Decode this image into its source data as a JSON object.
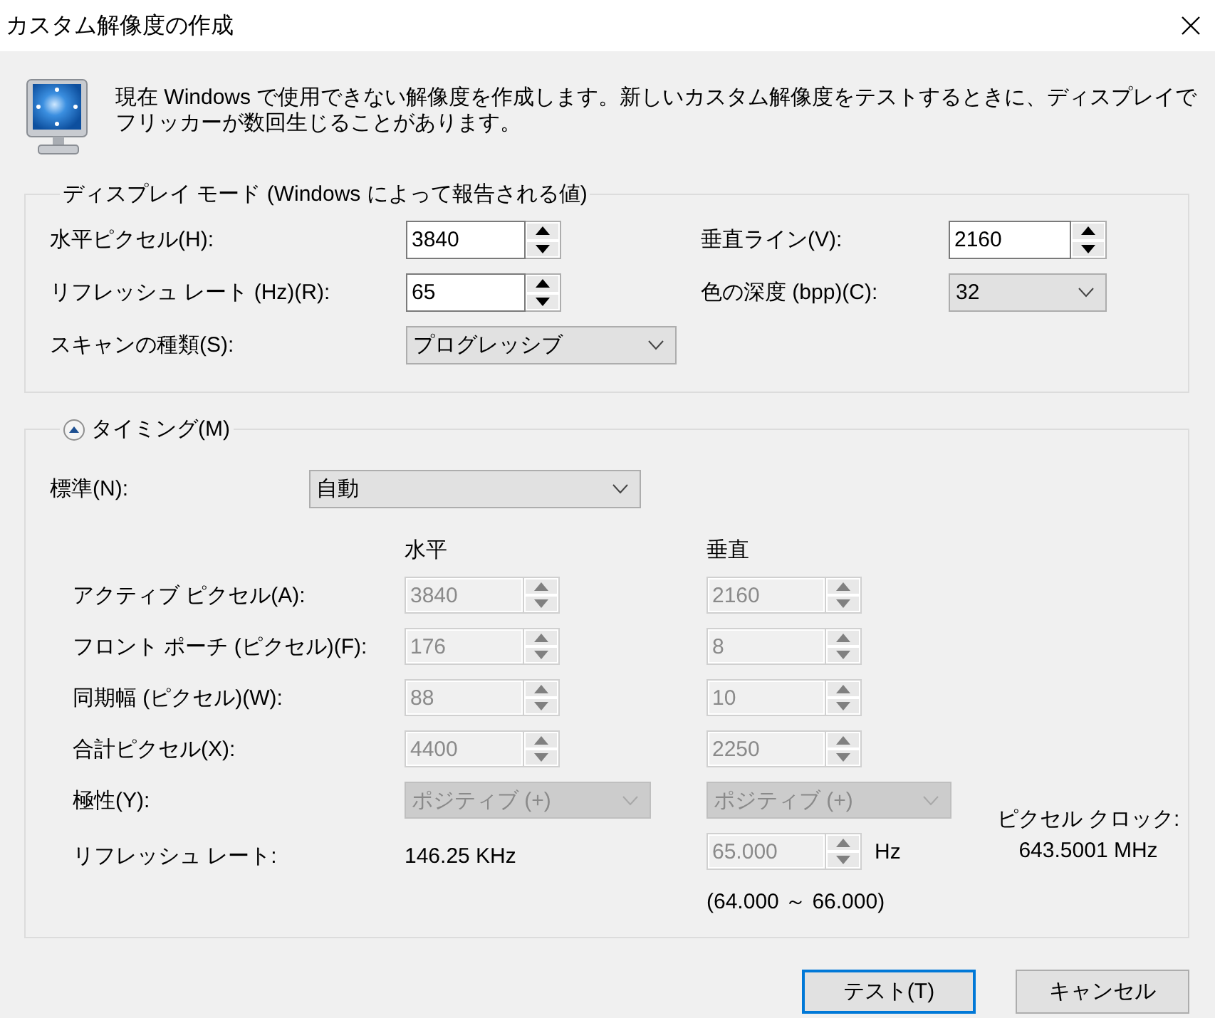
{
  "window": {
    "title": "カスタム解像度の作成"
  },
  "description": "現在 Windows で使用できない解像度を作成します。新しいカスタム解像度をテストするときに、ディスプレイでフリッカーが数回生じることがあります。",
  "display_mode": {
    "legend": "ディスプレイ モード (Windows によって報告される値)",
    "rows": [
      {
        "left": {
          "label": "水平ピクセル(H):",
          "kind": "spin",
          "value": "3840",
          "disabled": false
        },
        "right": {
          "label": "垂直ライン(V):",
          "kind": "spin",
          "value": "2160",
          "disabled": false
        }
      },
      {
        "left": {
          "label": "リフレッシュ レート (Hz)(R):",
          "kind": "spin",
          "value": "65",
          "disabled": false
        },
        "right": {
          "label": "色の深度 (bpp)(C):",
          "kind": "combo",
          "value": "32",
          "disabled": false
        }
      },
      {
        "left": {
          "label": "スキャンの種類(S):",
          "kind": "combo",
          "value": "プログレッシブ",
          "disabled": false
        }
      }
    ]
  },
  "timing": {
    "legend": "タイミング(M)",
    "expanded": true,
    "standard": {
      "label": "標準(N):",
      "value": "自動",
      "disabled": false
    },
    "columns": [
      "水平",
      "垂直"
    ],
    "rows": [
      {
        "label": "アクティブ ピクセル(A):",
        "horizontal": {
          "kind": "spin",
          "value": "3840",
          "disabled": true
        },
        "vertical": {
          "kind": "spin",
          "value": "2160",
          "disabled": true
        }
      },
      {
        "label": "フロント ポーチ (ピクセル)(F):",
        "horizontal": {
          "kind": "spin",
          "value": "176",
          "disabled": true
        },
        "vertical": {
          "kind": "spin",
          "value": "8",
          "disabled": true
        }
      },
      {
        "label": "同期幅 (ピクセル)(W):",
        "horizontal": {
          "kind": "spin",
          "value": "88",
          "disabled": true
        },
        "vertical": {
          "kind": "spin",
          "value": "10",
          "disabled": true
        }
      },
      {
        "label": "合計ピクセル(X):",
        "horizontal": {
          "kind": "spin",
          "value": "4400",
          "disabled": true
        },
        "vertical": {
          "kind": "spin",
          "value": "2250",
          "disabled": true
        }
      },
      {
        "label": "極性(Y):",
        "horizontal": {
          "kind": "combo",
          "value": "ポジティブ (+)",
          "disabled": true
        },
        "vertical": {
          "kind": "combo",
          "value": "ポジティブ (+)",
          "disabled": true
        }
      }
    ],
    "refresh": {
      "label": "リフレッシュ レート:",
      "horizontal": "146.25 KHz",
      "vertical": {
        "kind": "spin",
        "value": "65.000",
        "disabled": true
      },
      "unit": "Hz",
      "range": "(64.000 ～ 66.000)"
    },
    "pixel_clock": {
      "label": "ピクセル クロック:",
      "value": "643.5001 MHz"
    }
  },
  "buttons": [
    {
      "label": "テスト(T)",
      "default": true
    },
    {
      "label": "キャンセル",
      "default": false
    }
  ]
}
